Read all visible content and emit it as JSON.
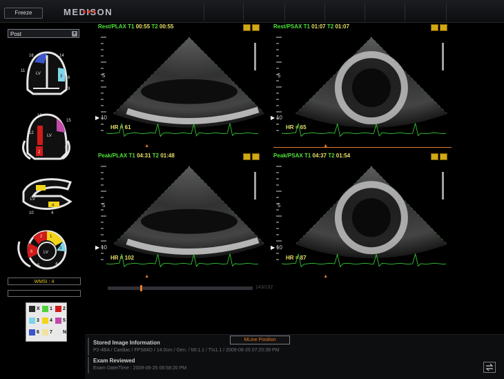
{
  "toolbar": {
    "freeze_label": "Freeze",
    "brand": "MEDISON"
  },
  "stage_select": {
    "value": "Post"
  },
  "diagrams": [
    {
      "name": "apical-4ch",
      "segments": [
        "16",
        "14",
        "11",
        "LV",
        "3",
        "6",
        "9"
      ]
    },
    {
      "name": "apical-2ch",
      "segments": [
        "13",
        "15",
        "12",
        "LV",
        "2",
        "5"
      ]
    },
    {
      "name": "long-axis",
      "segments": [
        "7",
        "LV",
        "4",
        "10",
        "4"
      ]
    },
    {
      "name": "short-axis",
      "segments": [
        "1",
        "2",
        "3",
        "4",
        "5",
        "6",
        "LV"
      ]
    }
  ],
  "wmsi": "WMSI : 4",
  "legend": [
    {
      "label": "X",
      "color": "#2a2a2a"
    },
    {
      "label": "1",
      "color": "#4fd13a"
    },
    {
      "label": "2",
      "color": "#d01b1b"
    },
    {
      "label": "3",
      "color": "#7fd4e8"
    },
    {
      "label": "4",
      "color": "#f2d51a"
    },
    {
      "label": "5",
      "color": "#c04aa8"
    },
    {
      "label": "6",
      "color": "#3c55c8"
    },
    {
      "label": "7",
      "color": "#f0e2a0"
    },
    {
      "label": "N",
      "color": "#e8e8e8"
    }
  ],
  "panes": [
    {
      "view": "Rest/PLAX",
      "t1_label": "T1",
      "t1": "00:55",
      "t2_label": "T2",
      "t2": "00:55",
      "hr": "HR = 61"
    },
    {
      "view": "Rest/PSAX",
      "t1_label": "T1",
      "t1": "01:07",
      "t2_label": "T2",
      "t2": "01:07",
      "hr": "HR = 65"
    },
    {
      "view": "Peak/PLAX",
      "t1_label": "T1",
      "t1": "04:31",
      "t2_label": "T2",
      "t2": "01:48",
      "hr": "HR = 102"
    },
    {
      "view": "Peak/PSAX",
      "t1_label": "T1",
      "t1": "04:37",
      "t2_label": "T2",
      "t2": "01:54",
      "hr": "HR = 87"
    }
  ],
  "depth_ticks": {
    "top": "5",
    "bottom": "10"
  },
  "cine": {
    "counter": "143/192",
    "progress": 0.31
  },
  "info": {
    "stored_title": "Stored Image Information",
    "stored_detail": "P2-4BA / Cardiac / FPS84D / 14.0cm / Gen. / MI:1.1 / TIs1.1 / 2009-06-25 07:20:39 PM",
    "exam_title": "Exam Reviewed",
    "exam_detail": "Exam Date/Time : 2009-06-25 06:58:20 PM",
    "mline_label": "MLine Position"
  },
  "colors": {
    "label_green": "#4fe33a",
    "time_yellow": "#e8e26a",
    "accent_orange": "#e57a2a",
    "ecg_green": "#2fb52f"
  }
}
